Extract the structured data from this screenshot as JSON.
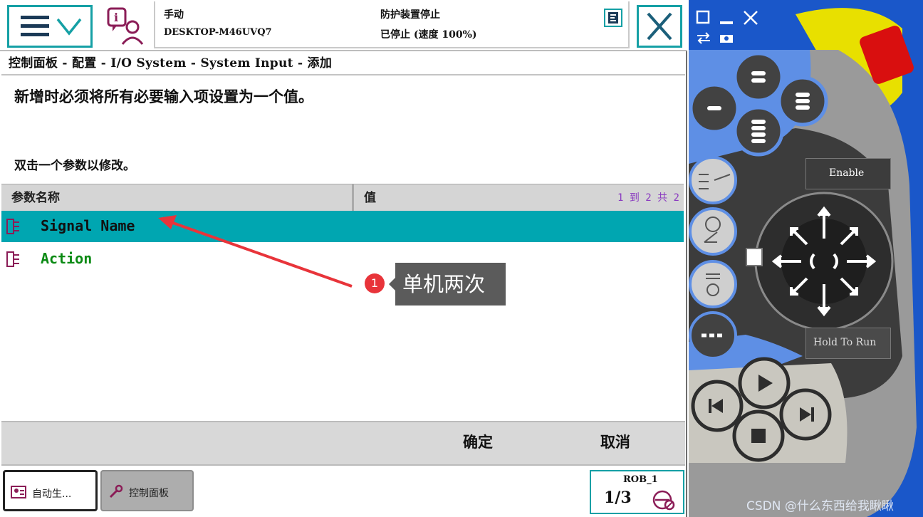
{
  "topbar": {
    "mode": "手动",
    "host": "DESKTOP-M46UVQ7",
    "safety_status": "防护装置停止",
    "run_status": "已停止 (速度 100%)"
  },
  "breadcrumb": "控制面板 - 配置 - I/O System - System Input - 添加",
  "instruction": "新增时必须将所有必要输入项设置为一个值。",
  "hint": "双击一个参数以修改。",
  "table": {
    "col_name": "参数名称",
    "col_value": "值",
    "paging": "1 到 2 共 2",
    "rows": [
      {
        "label": "Signal Name",
        "value": ""
      },
      {
        "label": "Action",
        "value": ""
      }
    ]
  },
  "actions": {
    "ok": "确定",
    "cancel": "取消"
  },
  "taskbar": {
    "task1": "自动生...",
    "task2": "控制面板",
    "rob": "ROB_1",
    "rob_fraction": "1/3"
  },
  "annotation": {
    "number": "1",
    "text": "单机两次"
  },
  "pendant": {
    "enable_label": "Enable",
    "hold_label": "Hold To Run"
  },
  "watermark": "CSDN @什么东西给我瞅瞅",
  "colors": {
    "accent": "#15a0a5",
    "selected_row": "#00a6b1",
    "action_green": "#0b8a14",
    "annotation_red": "#e8343a",
    "pendant_blue": "#1a57c9"
  }
}
